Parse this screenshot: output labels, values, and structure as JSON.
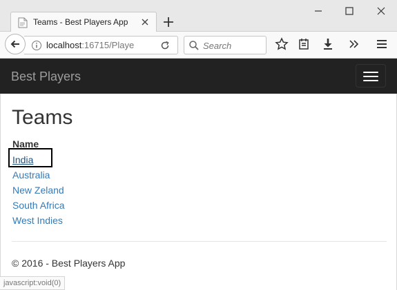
{
  "browser": {
    "tab_title": "Teams - Best Players App",
    "url_host": "localhost",
    "url_rest": ":16715/Playe",
    "search_placeholder": "Search",
    "status_text": "javascript:void(0)"
  },
  "app": {
    "brand": "Best Players",
    "page_title": "Teams",
    "column_header": "Name",
    "teams": [
      "India",
      "Australia",
      "New Zeland",
      "South Africa",
      "West Indies"
    ],
    "footer": "© 2016 - Best Players App",
    "link_color": "#337ab7",
    "navbar_color": "#222222"
  }
}
